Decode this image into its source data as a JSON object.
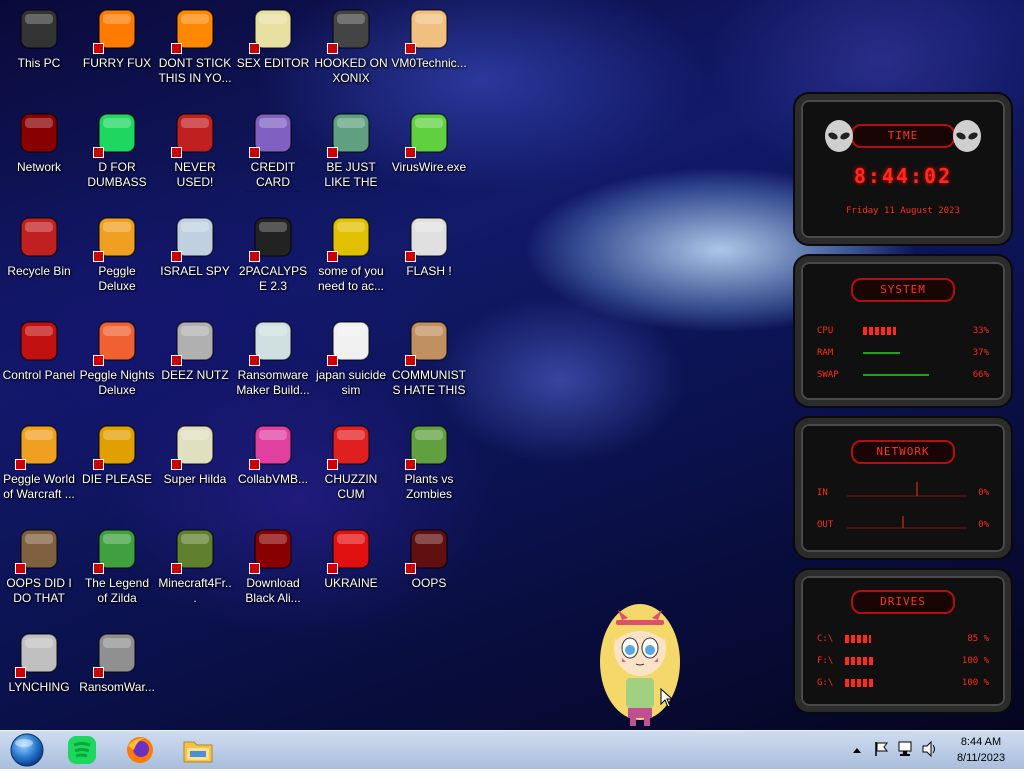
{
  "desktop_icons": [
    {
      "label": "This PC",
      "icon": "computer-icon",
      "color": "#333333"
    },
    {
      "label": "FURRY FUX",
      "icon": "firefox-icon",
      "color": "#ff7a00"
    },
    {
      "label": "DONT STICK THIS IN YO...",
      "icon": "traffic-cone-icon",
      "color": "#ff8800"
    },
    {
      "label": "SEX EDITOR",
      "icon": "xd-editor-icon",
      "color": "#e8e0a0"
    },
    {
      "label": "HOOKED ON XONIX",
      "icon": "xonix-game-icon",
      "color": "#444444"
    },
    {
      "label": "VM0Technic...",
      "icon": "doctor-icon",
      "color": "#f0c080"
    },
    {
      "label": "Network",
      "icon": "alien-orb-icon",
      "color": "#880000"
    },
    {
      "label": "D FOR DUMBASS",
      "icon": "spotify-green-icon",
      "color": "#1ed760"
    },
    {
      "label": "NEVER USED!",
      "icon": "dev-cpp-icon",
      "color": "#c02020"
    },
    {
      "label": "CREDIT CARD CHECKER",
      "icon": "credit-card-icon",
      "color": "#8060c0"
    },
    {
      "label": "BE JUST LIKE THE DUDE!",
      "icon": "gnome-icon",
      "color": "#60a080"
    },
    {
      "label": "VirusWire.exe",
      "icon": "lime-icon",
      "color": "#60d040"
    },
    {
      "label": "Recycle Bin",
      "icon": "recycle-bin-icon",
      "color": "#c02020"
    },
    {
      "label": "Peggle Deluxe",
      "icon": "peggle-icon",
      "color": "#f0a020"
    },
    {
      "label": "ISRAEL SPY",
      "icon": "network-spy-icon",
      "color": "#c0d0e0"
    },
    {
      "label": "2PACALYPSE 2.3",
      "icon": "terminal-icon",
      "color": "#222222"
    },
    {
      "label": "some of you need to ac...",
      "icon": "dog-icon",
      "color": "#e0c000"
    },
    {
      "label": "FLASH !",
      "icon": "flash-document-icon",
      "color": "#e0e0e0"
    },
    {
      "label": "Control Panel",
      "icon": "control-panel-icon",
      "color": "#c01010"
    },
    {
      "label": "Peggle Nights Deluxe",
      "icon": "peggle-nights-icon",
      "color": "#f06030"
    },
    {
      "label": "DEEZ NUTZ",
      "icon": "stacked-windows-icon",
      "color": "#b0b0b0"
    },
    {
      "label": "Ransomware Maker Build...",
      "icon": "app-window-icon",
      "color": "#d0e0e0"
    },
    {
      "label": "japan suicide sim",
      "icon": "blank-document-icon",
      "color": "#f0f0f0"
    },
    {
      "label": "COMMUNISTS HATE THIS G...",
      "icon": "money-bag-icon",
      "color": "#c09060"
    },
    {
      "label": "Peggle World of Warcraft ...",
      "icon": "peggle-wow-icon",
      "color": "#f0a020"
    },
    {
      "label": "DIE PLEASE",
      "icon": "de-icon",
      "color": "#e0a000"
    },
    {
      "label": "Super Hilda",
      "icon": "pixel-character-icon",
      "color": "#e0e0c0"
    },
    {
      "label": "CollabVMB...",
      "icon": "monitor-icon",
      "color": "#e040a0"
    },
    {
      "label": "CHUZZIN CUM",
      "icon": "chuzzle-icon",
      "color": "#e02020"
    },
    {
      "label": "Plants vs Zombies",
      "icon": "plants-icon",
      "color": "#60a040"
    },
    {
      "label": "OOPS DID I DO THAT",
      "icon": "portrait-icon",
      "color": "#806040"
    },
    {
      "label": "The Legend of Zilda",
      "icon": "legend-character-icon",
      "color": "#40a040"
    },
    {
      "label": "Minecraft4Fr...",
      "icon": "grass-block-icon",
      "color": "#608030"
    },
    {
      "label": "Download Black Ali...",
      "icon": "alien-orb-icon",
      "color": "#880000"
    },
    {
      "label": "UKRAINE",
      "icon": "radiation-icon",
      "color": "#e01010"
    },
    {
      "label": "OOPS",
      "icon": "red-window-icon",
      "color": "#601010"
    },
    {
      "label": "LYNCHING",
      "icon": "noose-icon",
      "color": "#c0c0c0"
    },
    {
      "label": "RansomWar...",
      "icon": "skull-ring-icon",
      "color": "#909090"
    }
  ],
  "gadget": {
    "time": {
      "title": "TIME",
      "clock": "8:44:02",
      "date": "Friday 11 August 2023"
    },
    "system": {
      "title": "SYSTEM",
      "rows": [
        {
          "label": "CPU",
          "value": "33%",
          "level": 0.33
        },
        {
          "label": "RAM",
          "value": "37%",
          "level": 0.37
        },
        {
          "label": "SWAP",
          "value": "66%",
          "level": 0.66
        }
      ]
    },
    "network": {
      "title": "NETWORK",
      "rows": [
        {
          "label": "IN",
          "value": "0%"
        },
        {
          "label": "OUT",
          "value": "0%"
        }
      ]
    },
    "drives": {
      "title": "DRIVES",
      "rows": [
        {
          "label": "C:\\",
          "value": "85 %",
          "level": 0.85
        },
        {
          "label": "F:\\",
          "value": "100 %",
          "level": 1.0
        },
        {
          "label": "G:\\",
          "value": "100 %",
          "level": 1.0
        }
      ]
    },
    "accent_color": "#ff2a1a"
  },
  "taskbar": {
    "start_icon": "windows-orb-icon",
    "pinned": [
      {
        "name": "spotify-green-icon"
      },
      {
        "name": "firefox-icon"
      },
      {
        "name": "file-explorer-icon"
      }
    ],
    "tray": {
      "time": "8:44 AM",
      "date": "8/11/2023"
    }
  }
}
